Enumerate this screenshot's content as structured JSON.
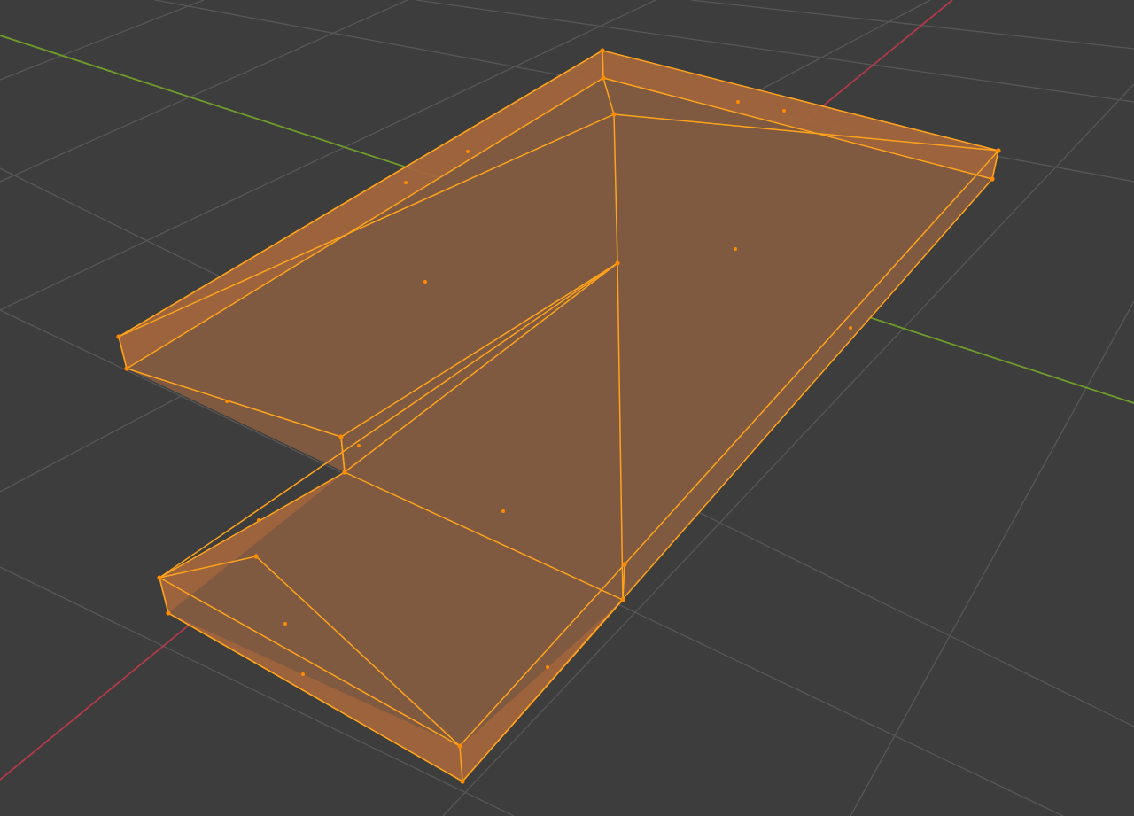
{
  "viewport": {
    "mode": "Edit Mode",
    "background_color": "#3d3d3d",
    "grid_color": "#555555",
    "x_axis_color": "#b03a48",
    "y_axis_color": "#6f9b2b"
  },
  "mesh": {
    "selected": true,
    "select_mode": "face",
    "x_ray": true,
    "face_fill_color": "#9a5e3a",
    "top_face_color": "#835b41",
    "edge_color": "#ffa31c",
    "vertex_color": "#ff8c00",
    "face_dot_color": "#ff8c00"
  }
}
